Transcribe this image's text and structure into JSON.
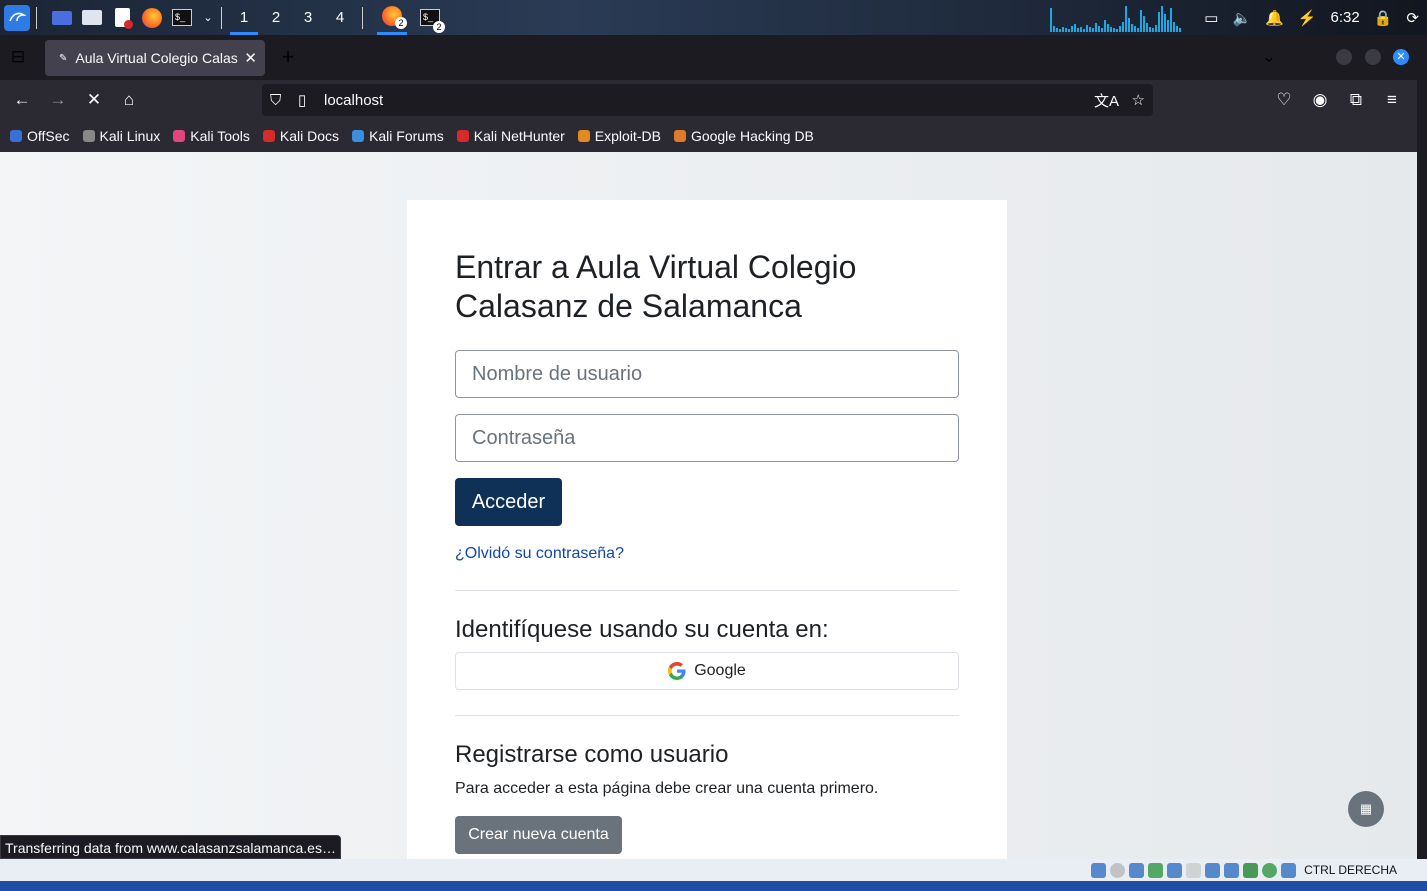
{
  "kali_panel": {
    "workspaces": [
      "1",
      "2",
      "3",
      "4"
    ],
    "active_workspace": "1",
    "badge_firefox": "2",
    "badge_terminal": "2",
    "clock": "6:32"
  },
  "browser": {
    "tab_title": "Aula Virtual Colegio Calas",
    "url": "localhost",
    "bookmarks": [
      {
        "label": "OffSec",
        "color": "#3b6fd8"
      },
      {
        "label": "Kali Linux",
        "color": "#888888"
      },
      {
        "label": "Kali Tools",
        "color": "#e0457b"
      },
      {
        "label": "Kali Docs",
        "color": "#d62b2b"
      },
      {
        "label": "Kali Forums",
        "color": "#3b8de0"
      },
      {
        "label": "Kali NetHunter",
        "color": "#d62b2b"
      },
      {
        "label": "Exploit-DB",
        "color": "#e48a23"
      },
      {
        "label": "Google Hacking DB",
        "color": "#e07a2b"
      }
    ],
    "status_text": "Transferring data from www.calasanzsalamanca.es…"
  },
  "login": {
    "title": "Entrar a Aula Virtual Colegio Calasanz de Salamanca",
    "username_placeholder": "Nombre de usuario",
    "password_placeholder": "Contraseña",
    "submit_label": "Acceder",
    "forgot_label": "¿Olvidó su contraseña?",
    "identity_heading": "Identifíquese usando su cuenta en:",
    "google_label": "Google",
    "register_heading": "Registrarse como usuario",
    "register_help": "Para acceder a esta página debe crear una cuenta primero.",
    "register_button": "Crear nueva cuenta"
  },
  "vbox": {
    "host_key": "CTRL DERECHA"
  },
  "colors": {
    "primary": "#0f3057",
    "link": "#0f47ad",
    "secondary": "#6a737b"
  }
}
